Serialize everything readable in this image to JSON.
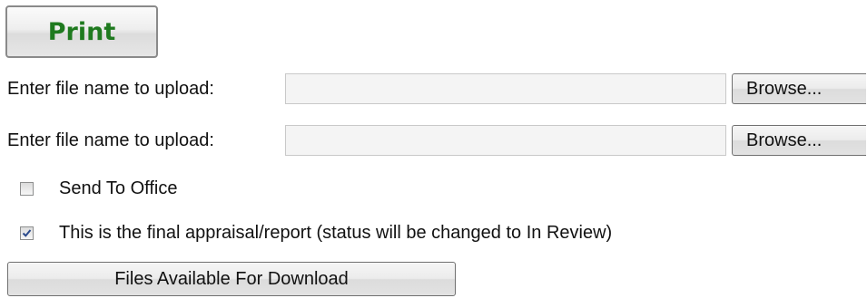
{
  "print_button": {
    "label": "Print",
    "color": "#1f7a1f"
  },
  "uploads": [
    {
      "label": "Enter file name to upload:",
      "value": "",
      "browse_label": "Browse..."
    },
    {
      "label": "Enter file name to upload:",
      "value": "",
      "browse_label": "Browse..."
    }
  ],
  "options": [
    {
      "label": "Send To Office",
      "checked": false
    },
    {
      "label": "This is the final appraisal/report (status will be changed to In Review)",
      "checked": true
    }
  ],
  "files_button": {
    "label": "Files Available For Download"
  }
}
